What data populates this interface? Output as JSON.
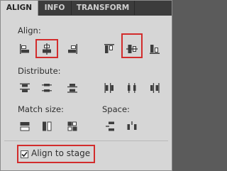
{
  "tabs": [
    {
      "label": "ALIGN",
      "active": true
    },
    {
      "label": "INFO",
      "active": false
    },
    {
      "label": "TRANSFORM",
      "active": false
    }
  ],
  "sections": {
    "align": "Align:",
    "distribute": "Distribute:",
    "match_size": "Match size:",
    "space": "Space:"
  },
  "align_to_stage": {
    "label": "Align to stage",
    "checked": true
  },
  "highlight_color": "#d22c2c"
}
